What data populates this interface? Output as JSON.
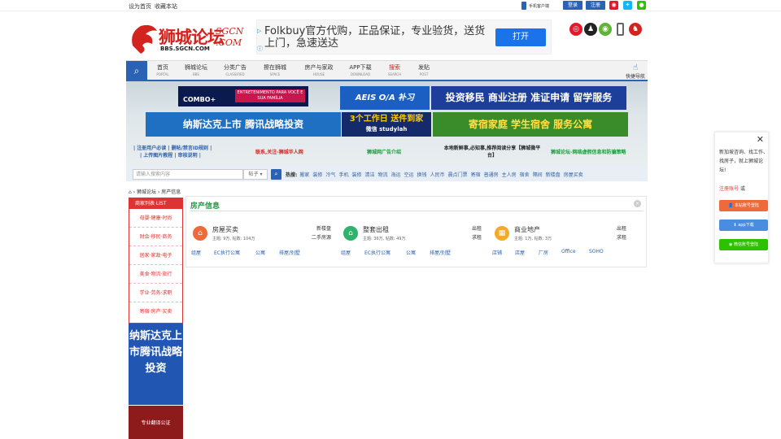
{
  "topbar": {
    "set_home": "设为首页",
    "bookmark": "收藏本站",
    "mobile": "手机客户端",
    "login": "登录",
    "register": "注册"
  },
  "header": {
    "logo_text": "狮城论坛",
    "logo_sub": "BBS.SGCN.COM",
    "logo_domain": "SGCN .COM"
  },
  "ad": {
    "text": "Folkbuy官方代购，正品保证，专业验货，送货上门，急速送达",
    "button": "打开"
  },
  "nav": {
    "items": [
      {
        "zh": "首页",
        "en": "PORTAL"
      },
      {
        "zh": "狮城论坛",
        "en": "BBS"
      },
      {
        "zh": "分类广告",
        "en": "CLASSIFIED"
      },
      {
        "zh": "擦在狮城",
        "en": "SPACE"
      },
      {
        "zh": "房产与家政",
        "en": "HOUSE"
      },
      {
        "zh": "APP下载",
        "en": "DOWNLOAD"
      },
      {
        "zh": "搜索",
        "en": "SEARCH"
      },
      {
        "zh": "发贴",
        "en": "POST"
      }
    ],
    "quick": "快捷导航"
  },
  "banners": {
    "disney_combo": "COMBO+",
    "disney_tag": "ENTRETENIMENTO PARA VOCÊ E SUA FAMÍLIA",
    "aeis": "AEIS O/A",
    "aeis2": "补习",
    "immig": "投资移民 商业注册 准证申请 留学服务",
    "nasdaq": "纳斯达克上市 腾讯战略投资",
    "study": "3个工作日 送件到家",
    "study_sub": "微信 studylah",
    "lodge": "寄宿家庭 学生宿舍 服务公寓"
  },
  "links": {
    "a1": "| 注册用户必读 | 删帖/禁言ID规则 |",
    "a2": "| 上传图片教程 | 审核说明 |",
    "b": "联系,关注-狮城华人网",
    "c": "狮城网广告介绍",
    "d": "本地新鲜事,必知事,推荐阅读分享【狮城微平台】",
    "e": "狮城论坛-网络虚假信息和防骗策略"
  },
  "search": {
    "placeholder": "请输入搜索内容",
    "select": "帖子",
    "hot_label": "热搜:",
    "hot": [
      "搬家",
      "装修",
      "冷气",
      "手机",
      "装修",
      "清洁",
      "物流",
      "海运",
      "空运",
      "换钱",
      "人民币",
      "晨点门票",
      "寄宿",
      "普通房",
      "主人房",
      "宿舍",
      "隔间",
      "新楼盘",
      "房屋买卖"
    ]
  },
  "breadcrumb": {
    "home": "狮城论坛",
    "current": "房产信息"
  },
  "sidebar": {
    "header": "商家列表 LIST",
    "items": [
      "母婴·健康·时尚",
      "财会·移民·商务",
      "居家·家政·电子",
      "美食·物流·旅行",
      "学业·劳务·求职",
      "寄宿·房产·买卖"
    ]
  },
  "side_ad": {
    "text": "纳斯达克上市腾讯战略投资",
    "bottom": "专业翻译公证"
  },
  "main": {
    "title": "房产信息",
    "categories": [
      {
        "icon": "house-icon",
        "name": "房屋买卖",
        "stats": "主题: 9万, 帖数: 104万",
        "tags": [
          "新楼盘",
          "二手房源"
        ],
        "color": "#f0693a"
      },
      {
        "icon": "home-rent-icon",
        "name": "整套出租",
        "stats": "主题: 36万, 帖数: 49万",
        "tags": [
          "出租",
          "求租"
        ],
        "color": "#2db36b"
      },
      {
        "icon": "building-icon",
        "name": "商业地产",
        "stats": "主题: 1万, 帖数: 3万",
        "tags": [
          "出租",
          "求租"
        ],
        "color": "#f4a92c"
      }
    ],
    "subs": [
      "组屋",
      "EC执行公寓",
      "公寓",
      "排屋/别墅",
      "组屋",
      "EC执行公寓",
      "公寓",
      "排屋/别墅",
      "店铺",
      "店屋",
      "厂房",
      "Office",
      "SOHO"
    ]
  },
  "float": {
    "message": "新加坡咨询、找工作、找房子，就上狮城论坛!",
    "register": "注册账号",
    "or": "或",
    "btn1": "本站账号登陆",
    "btn2": "app下载",
    "btn3": "微信账号登陆"
  }
}
